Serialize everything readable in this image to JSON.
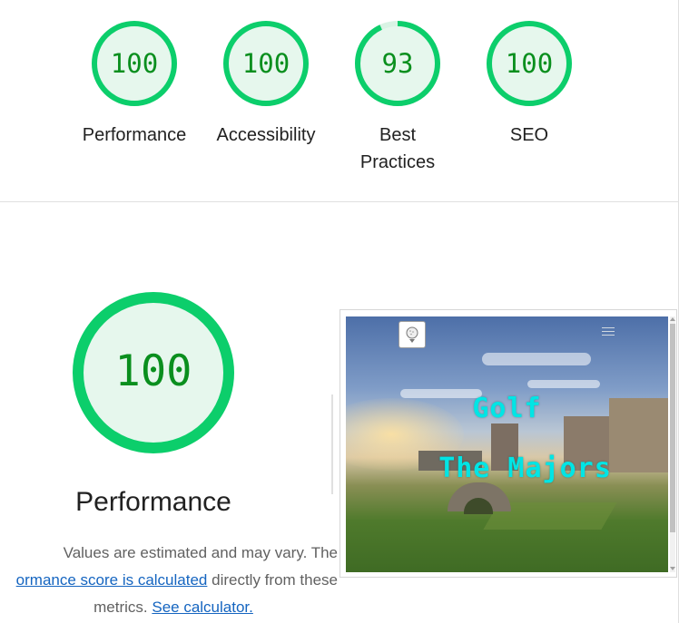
{
  "colors": {
    "pass": "#0cce6b",
    "pass_fill": "#e6f7ed",
    "score_text": "#0a8f1e",
    "link": "#1565c0"
  },
  "categories": [
    {
      "score": 100,
      "score_text": "100",
      "label": "Performance"
    },
    {
      "score": 100,
      "score_text": "100",
      "label": "Accessibility"
    },
    {
      "score": 93,
      "score_text": "93",
      "label_line1": "Best",
      "label_line2": "Practices"
    },
    {
      "score": 100,
      "score_text": "100",
      "label": "SEO"
    }
  ],
  "performance": {
    "score": 100,
    "score_text": "100",
    "title": "Performance",
    "desc_part1": "Values are estimated and may vary. The",
    "desc_link1": "ormance score is calculated",
    "desc_part2": " directly from these",
    "desc_part3": "metrics. ",
    "desc_link2": "See calculator."
  },
  "screenshot": {
    "title_line1": "Golf",
    "title_line2": "The Majors",
    "logo_icon": "golf-ball-icon",
    "menu_icon": "hamburger-menu-icon"
  }
}
